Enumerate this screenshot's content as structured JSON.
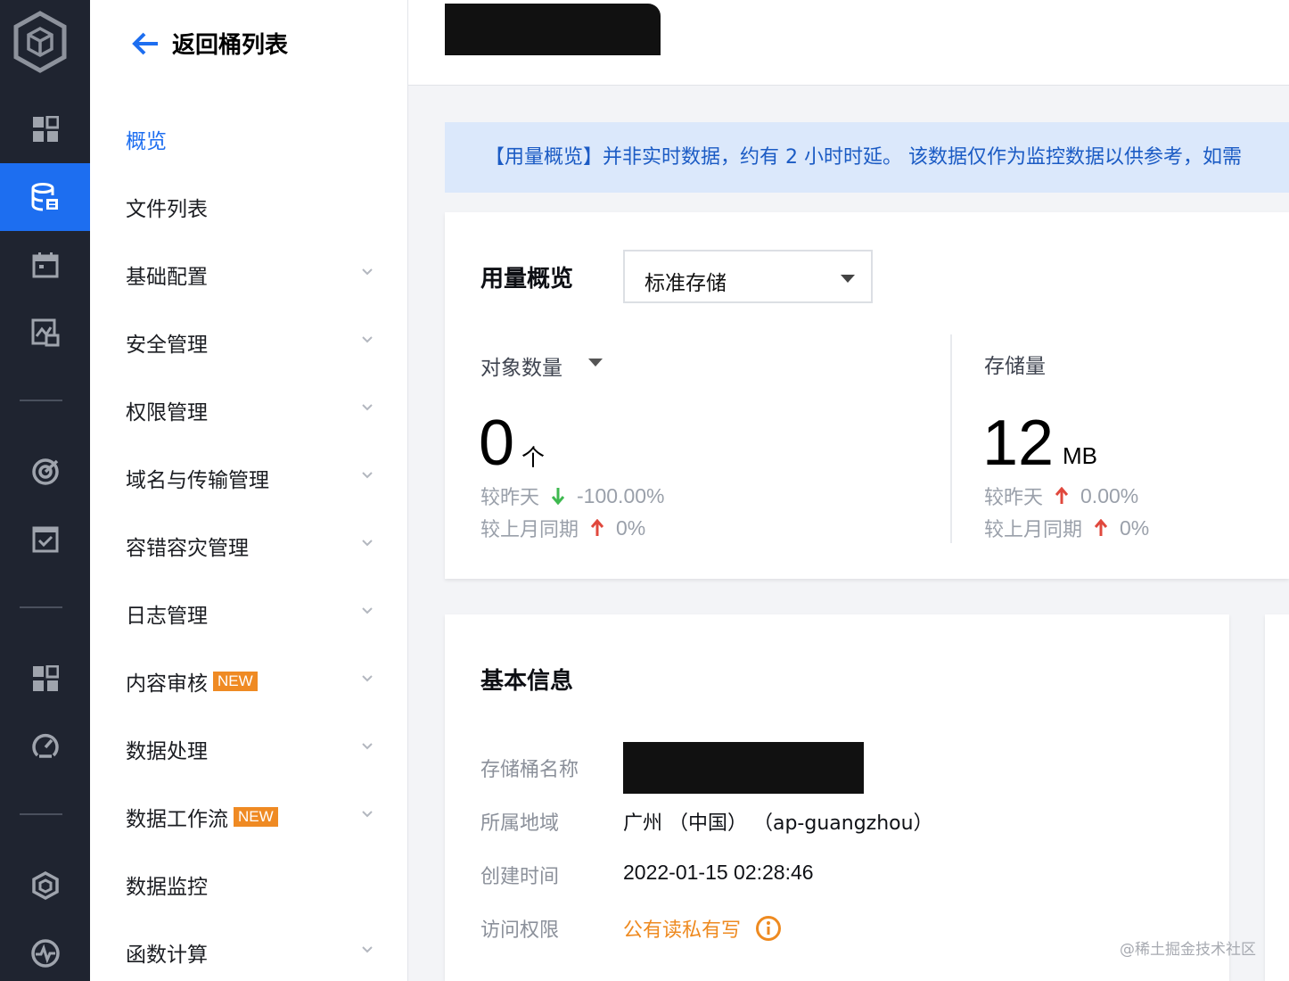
{
  "sidebar_rail": {
    "items": [
      {
        "icon": "grid-icon"
      },
      {
        "icon": "database-icon",
        "active": true
      },
      {
        "icon": "calendar-icon"
      },
      {
        "icon": "image-monitor-icon"
      },
      {
        "icon": "radar-icon"
      },
      {
        "icon": "checkbox-icon"
      },
      {
        "icon": "grid-icon"
      },
      {
        "icon": "dashboard-gauge-icon"
      },
      {
        "icon": "cube-icon"
      },
      {
        "icon": "pulse-icon"
      }
    ]
  },
  "subnav": {
    "back_label": "返回桶列表",
    "items": [
      {
        "label": "概览",
        "active": true
      },
      {
        "label": "文件列表"
      },
      {
        "label": "基础配置"
      },
      {
        "label": "安全管理"
      },
      {
        "label": "权限管理"
      },
      {
        "label": "域名与传输管理"
      },
      {
        "label": "容错容灾管理"
      },
      {
        "label": "日志管理"
      },
      {
        "label": "内容审核",
        "badge": "NEW"
      },
      {
        "label": "数据处理"
      },
      {
        "label": "数据工作流",
        "badge": "NEW"
      },
      {
        "label": "数据监控"
      },
      {
        "label": "函数计算"
      }
    ]
  },
  "notice": {
    "text": "【用量概览】并非实时数据，约有 2 小时时延。 该数据仅作为监控数据以供参考，如需"
  },
  "usage": {
    "title": "用量概览",
    "storage_class": "标准存储",
    "objects": {
      "label": "对象数量",
      "value": "0",
      "unit": "个",
      "vs_yesterday_label": "较昨天",
      "vs_yesterday": "-100.00%",
      "vs_last_month_label": "较上月同期",
      "vs_last_month": "0%"
    },
    "storage": {
      "label": "存储量",
      "value": "12",
      "unit": "MB",
      "vs_yesterday_label": "较昨天",
      "vs_yesterday": "0.00%",
      "vs_last_month_label": "较上月同期",
      "vs_last_month": "0%"
    }
  },
  "basic_info": {
    "title": "基本信息",
    "bucket_name_label": "存储桶名称",
    "region_label": "所属地域",
    "region_value": "广州 （中国） （ap-guangzhou）",
    "created_label": "创建时间",
    "created_value": "2022-01-15 02:28:46",
    "access_label": "访问权限",
    "access_value": "公有读私有写"
  },
  "watermark": "@稀土掘金技术社区",
  "colors": {
    "accent": "#1d6ef0",
    "rail_bg": "#1f2430",
    "down_arrow": "#3fb950",
    "up_arrow": "#e0483d",
    "badge": "#ef8a23"
  }
}
